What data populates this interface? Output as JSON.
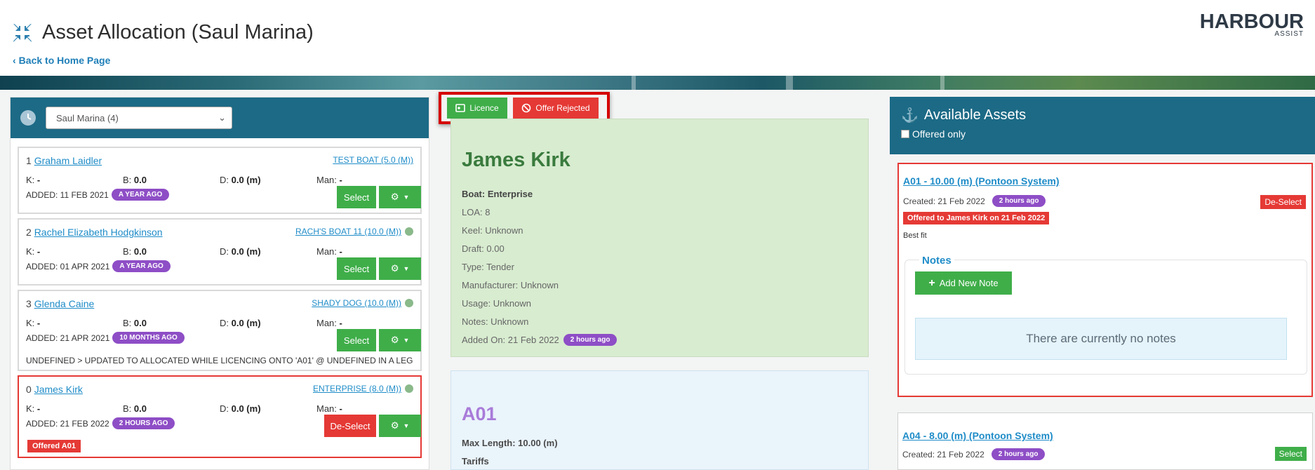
{
  "header": {
    "title": "Asset Allocation (Saul Marina)",
    "back_link": "Back to Home Page",
    "logo_text": "HARBOUR",
    "logo_sub": "ASSIST"
  },
  "waitlist": {
    "marina_select_value": "Saul Marina (4)",
    "cards": [
      {
        "position": "1",
        "name": "Graham Laidler",
        "boat": "TEST BOAT (5.0 (M))",
        "k_label": "K:",
        "k_value": "-",
        "b_label": "B:",
        "b_value": "0.0",
        "d_label": "D:",
        "d_value": "0.0 (m)",
        "man_label": "Man:",
        "man_value": "-",
        "added": "ADDED: 11 FEB 2021",
        "age": "A YEAR AGO",
        "action": "Select"
      },
      {
        "position": "2",
        "name": "Rachel Elizabeth Hodgkinson",
        "boat": "RACH'S BOAT 11 (10.0 (M))",
        "k_label": "K:",
        "k_value": "-",
        "b_label": "B:",
        "b_value": "0.0",
        "d_label": "D:",
        "d_value": "0.0 (m)",
        "man_label": "Man:",
        "man_value": "-",
        "added": "ADDED: 01 APR 2021",
        "age": "A YEAR AGO",
        "action": "Select"
      },
      {
        "position": "3",
        "name": "Glenda Caine",
        "boat": "SHADY DOG (10.0 (M))",
        "k_label": "K:",
        "k_value": "-",
        "b_label": "B:",
        "b_value": "0.0",
        "d_label": "D:",
        "d_value": "0.0 (m)",
        "man_label": "Man:",
        "man_value": "-",
        "added": "ADDED: 21 APR 2021",
        "age": "10 MONTHS AGO",
        "action": "Select",
        "note": "UNDEFINED > UPDATED TO ALLOCATED WHILE LICENCING ONTO 'A01' @ UNDEFINED IN A LEG"
      },
      {
        "position": "0",
        "name": "James Kirk",
        "boat": "ENTERPRISE (8.0 (M))",
        "k_label": "K:",
        "k_value": "-",
        "b_label": "B:",
        "b_value": "0.0",
        "d_label": "D:",
        "d_value": "0.0 (m)",
        "man_label": "Man:",
        "man_value": "-",
        "added": "ADDED: 21 FEB 2022",
        "age": "2 HOURS AGO",
        "action": "De-Select",
        "offered": "Offered A01"
      }
    ]
  },
  "actions": {
    "licence": "Licence",
    "offer_rejected": "Offer Rejected"
  },
  "boater": {
    "name": "James Kirk",
    "boat": "Boat: Enterprise",
    "loa": "LOA: 8",
    "keel": "Keel: Unknown",
    "draft": "Draft: 0.00",
    "type": "Type: Tender",
    "manufacturer": "Manufacturer: Unknown",
    "usage": "Usage: Unknown",
    "notes": "Notes: Unknown",
    "added_on": "Added On: 21 Feb 2022",
    "added_age": "2 hours ago"
  },
  "asset": {
    "name": "A01",
    "max_length": "Max Length: 10.00 (m)",
    "tariffs": "Tariffs"
  },
  "available_assets": {
    "title": "Available Assets",
    "offered_only_label": "Offered only",
    "items": [
      {
        "title": "A01 - 10.00 (m) (Pontoon System)",
        "created": "Created: 21 Feb 2022",
        "age": "2 hours ago",
        "button": "De-Select",
        "offer": "Offered to James Kirk on 21 Feb 2022",
        "fit": "Best fit",
        "notes_title": "Notes",
        "add_note": "Add New Note",
        "empty_notes": "There are currently no notes"
      },
      {
        "title": "A04 - 8.00 (m) (Pontoon System)",
        "created": "Created: 21 Feb 2022",
        "age": "2 hours ago",
        "button": "Select"
      }
    ]
  },
  "colors": {
    "primary_teal": "#1c6a86",
    "green": "#3fae49",
    "red": "#e53935",
    "purple": "#8e4ec6",
    "link_blue": "#1f8cc8"
  }
}
